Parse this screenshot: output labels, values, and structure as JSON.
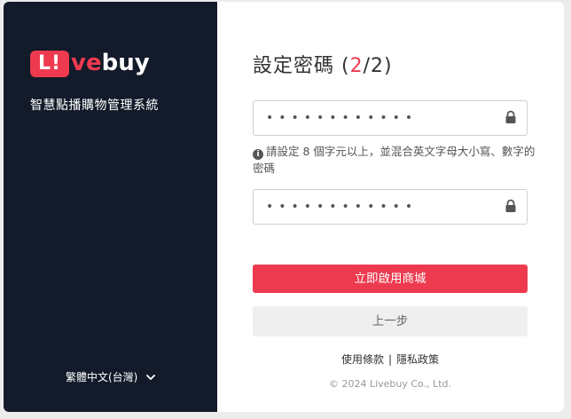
{
  "brand": {
    "badge_text": "L!",
    "rest_main": "ve",
    "rest_buy": "buy",
    "tagline": "智慧點播購物管理系統"
  },
  "language": {
    "label": "繁體中文(台灣)"
  },
  "form": {
    "title_prefix": "設定密碼 (",
    "step_current": "2",
    "title_suffix": "/2)",
    "password_value": "••••••••••••",
    "confirm_value": "••••••••••••",
    "hint": "請設定 8 個字元以上，並混合英文字母大小寫、數字的密碼",
    "primary_button": "立即啟用商城",
    "secondary_button": "上一步"
  },
  "footer": {
    "terms": "使用條款",
    "separator": "|",
    "privacy": "隱私政策",
    "copyright": "© 2024 Livebuy Co., Ltd."
  },
  "colors": {
    "accent": "#ee3a4f",
    "sidebar": "#131a2a"
  },
  "icons": [
    "lock-icon",
    "info-icon",
    "chevron-down-icon"
  ]
}
